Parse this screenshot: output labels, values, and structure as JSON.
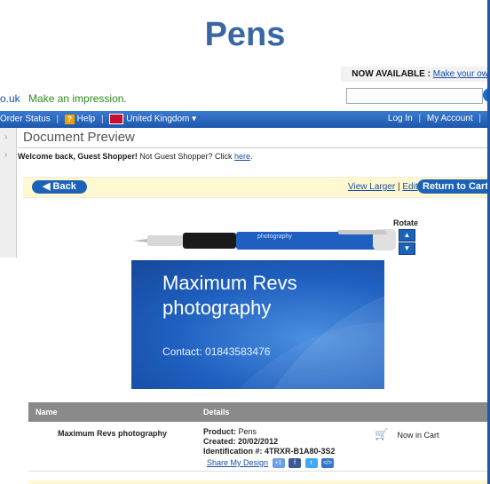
{
  "header": {
    "title": "Pens",
    "now_available_label": "NOW AVAILABLE :",
    "now_available_link": "Make your ow",
    "domain_fragment": "o.uk",
    "tagline": "Make an impression."
  },
  "navbar": {
    "order_status": "Order Status",
    "help": "Help",
    "region": "United Kingdom",
    "login": "Log In",
    "my_account": "My Account"
  },
  "page": {
    "title": "Document Preview",
    "welcome_bold": "Welcome back, Guest Shopper!",
    "welcome_rest": "Not Guest Shopper? Click",
    "welcome_link": "here"
  },
  "actions": {
    "back": "Back",
    "view_larger": "View Larger",
    "edit": "Edit",
    "return_to_cart": "Return to Cart",
    "rotate": "Rotate"
  },
  "design": {
    "pen_text": "photography",
    "card_line1": "Maximum Revs",
    "card_line2": "photography",
    "card_contact": "Contact: 01843583476"
  },
  "table": {
    "headers": [
      "Name",
      "Details"
    ],
    "row": {
      "name": "Maximum Revs photography",
      "product_label": "Product:",
      "product": "Pens",
      "created_label": "Created:",
      "created": "20/02/2012",
      "id_label": "Identification #:",
      "id": "4TRXR-B1A80-3S2",
      "share_link": "Share My Design",
      "cart_status": "Now in Cart"
    }
  },
  "colors": {
    "brand_blue": "#1c63b8",
    "title_blue": "#3a67a3",
    "tagline_green": "#2e8b1f"
  }
}
